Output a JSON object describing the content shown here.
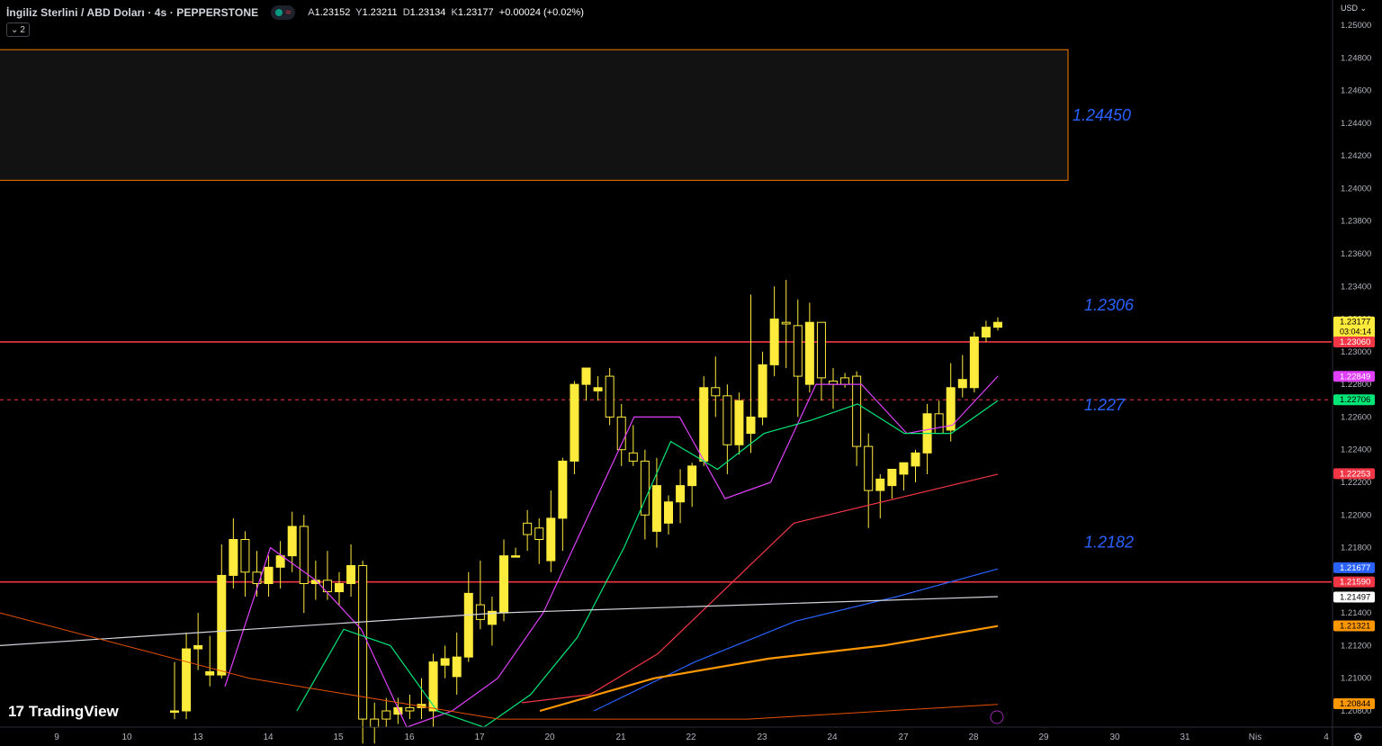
{
  "header": {
    "title": "İngiliz Sterlini / ABD Doları · 4s · PEPPERSTONE",
    "ohlc": {
      "open_label": "A",
      "open": "1.23152",
      "high_label": "Y",
      "high": "1.23211",
      "low_label": "D",
      "low": "1.23134",
      "close_label": "K",
      "close": "1.23177",
      "change": "+0.00024 (+0.02%)"
    },
    "indicator_count": "2",
    "currency": "USD"
  },
  "logo": {
    "text": "TradingView"
  },
  "colors": {
    "candle": "#ffeb3b",
    "wick": "#ffeb3b",
    "level_line": "#f23645",
    "zone_border": "#f57c00",
    "annotation": "#2962ff",
    "ma_purple": "#e040fb",
    "ma_green": "#00e676",
    "ma_red": "#f23645",
    "ma_blue": "#2962ff",
    "ma_white": "#d1d4dc",
    "ma_orange": "#ff9800",
    "ma_orange_thin": "#e65100"
  },
  "chart_data": {
    "type": "candlestick",
    "symbol": "GBPUSD",
    "timeframe": "4s",
    "ylim": [
      1.2075,
      1.251
    ],
    "y_ticks": [
      "1.25000",
      "1.24800",
      "1.24600",
      "1.24400",
      "1.24200",
      "1.24000",
      "1.23800",
      "1.23600",
      "1.23400",
      "1.23200",
      "1.23000",
      "1.22800",
      "1.22600",
      "1.22400",
      "1.22200",
      "1.22000",
      "1.21800",
      "1.21600",
      "1.21400",
      "1.21200",
      "1.21000",
      "1.20800"
    ],
    "x_ticks": [
      "9",
      "10",
      "13",
      "14",
      "15",
      "16",
      "17",
      "20",
      "21",
      "22",
      "23",
      "24",
      "27",
      "28",
      "29",
      "30",
      "31",
      "Nis",
      "4"
    ],
    "candles": [
      [
        1.208,
        1.211,
        1.2075,
        1.208
      ],
      [
        1.208,
        1.2128,
        1.2075,
        1.2118
      ],
      [
        1.2118,
        1.214,
        1.2105,
        1.212
      ],
      [
        1.2102,
        1.2126,
        1.2095,
        1.2104
      ],
      [
        1.2102,
        1.2182,
        1.21,
        1.2163
      ],
      [
        1.2163,
        1.2198,
        1.2155,
        1.2185
      ],
      [
        1.2185,
        1.219,
        1.215,
        1.2165
      ],
      [
        1.2165,
        1.2178,
        1.215,
        1.2158
      ],
      [
        1.2158,
        1.2175,
        1.215,
        1.2168
      ],
      [
        1.2168,
        1.2184,
        1.2155,
        1.2175
      ],
      [
        1.2175,
        1.2202,
        1.2165,
        1.2193
      ],
      [
        1.2193,
        1.22,
        1.214,
        1.2158
      ],
      [
        1.2158,
        1.2172,
        1.2148,
        1.216
      ],
      [
        1.216,
        1.2178,
        1.2148,
        1.2153
      ],
      [
        1.2153,
        1.2165,
        1.2145,
        1.2158
      ],
      [
        1.2158,
        1.2182,
        1.215,
        1.2169
      ],
      [
        1.2169,
        1.2172,
        1.206,
        1.2075
      ],
      [
        1.2075,
        1.2085,
        1.206,
        1.207
      ],
      [
        1.208,
        1.2088,
        1.207,
        1.2075
      ],
      [
        1.2078,
        1.2088,
        1.2072,
        1.2082
      ],
      [
        1.2082,
        1.209,
        1.2075,
        1.208
      ],
      [
        1.2082,
        1.21,
        1.2075,
        1.2084
      ],
      [
        1.208,
        1.2115,
        1.207,
        1.211
      ],
      [
        1.2108,
        1.212,
        1.21,
        1.2112
      ],
      [
        1.2101,
        1.2128,
        1.209,
        1.2113
      ],
      [
        1.2113,
        1.2165,
        1.211,
        1.2152
      ],
      [
        1.2145,
        1.2172,
        1.213,
        1.2136
      ],
      [
        1.2133,
        1.215,
        1.212,
        1.2141
      ],
      [
        1.214,
        1.2185,
        1.2135,
        1.2175
      ],
      [
        1.2175,
        1.218,
        1.2175,
        1.2175
      ],
      [
        1.2195,
        1.2203,
        1.2178,
        1.2188
      ],
      [
        1.2192,
        1.2198,
        1.217,
        1.2185
      ],
      [
        1.2172,
        1.2215,
        1.2165,
        1.2198
      ],
      [
        1.2198,
        1.2235,
        1.2178,
        1.2233
      ],
      [
        1.2233,
        1.2282,
        1.2225,
        1.228
      ],
      [
        1.228,
        1.2285,
        1.227,
        1.229
      ],
      [
        1.2276,
        1.2285,
        1.227,
        1.2278
      ],
      [
        1.2285,
        1.229,
        1.2255,
        1.226
      ],
      [
        1.226,
        1.2268,
        1.223,
        1.224
      ],
      [
        1.2238,
        1.2255,
        1.223,
        1.2233
      ],
      [
        1.2233,
        1.224,
        1.2185,
        1.22
      ],
      [
        1.219,
        1.2235,
        1.218,
        1.2218
      ],
      [
        1.2195,
        1.2212,
        1.2188,
        1.2208
      ],
      [
        1.2208,
        1.2228,
        1.2195,
        1.2218
      ],
      [
        1.2218,
        1.2232,
        1.2205,
        1.223
      ],
      [
        1.2233,
        1.2285,
        1.223,
        1.2278
      ],
      [
        1.2278,
        1.2297,
        1.226,
        1.2273
      ],
      [
        1.2273,
        1.228,
        1.2225,
        1.2243
      ],
      [
        1.2243,
        1.2275,
        1.2237,
        1.227
      ],
      [
        1.225,
        1.2335,
        1.2238,
        1.226
      ],
      [
        1.226,
        1.23,
        1.2255,
        1.2292
      ],
      [
        1.2292,
        1.234,
        1.2285,
        1.232
      ],
      [
        1.2318,
        1.2344,
        1.229,
        1.2317
      ],
      [
        1.2316,
        1.2332,
        1.226,
        1.2285
      ],
      [
        1.228,
        1.233,
        1.2275,
        1.2318
      ],
      [
        1.2318,
        1.2318,
        1.227,
        1.2284
      ],
      [
        1.2282,
        1.229,
        1.2265,
        1.228
      ],
      [
        1.2284,
        1.2287,
        1.2278,
        1.228
      ],
      [
        1.2285,
        1.2288,
        1.223,
        1.2242
      ],
      [
        1.2242,
        1.225,
        1.2192,
        1.2215
      ],
      [
        1.2215,
        1.2225,
        1.2198,
        1.2222
      ],
      [
        1.2218,
        1.2228,
        1.221,
        1.2228
      ],
      [
        1.2225,
        1.223,
        1.2215,
        1.2232
      ],
      [
        1.223,
        1.224,
        1.222,
        1.2238
      ],
      [
        1.2238,
        1.2268,
        1.2225,
        1.2262
      ],
      [
        1.2262,
        1.227,
        1.225,
        1.225
      ],
      [
        1.2252,
        1.2293,
        1.2245,
        1.2278
      ],
      [
        1.2278,
        1.2298,
        1.2272,
        1.2283
      ],
      [
        1.2278,
        1.2312,
        1.2275,
        1.2309
      ],
      [
        1.2309,
        1.2319,
        1.2306,
        1.2315
      ],
      [
        1.2315,
        1.2321,
        1.2313,
        1.2318
      ]
    ],
    "moving_averages": [
      {
        "color": "#e040fb",
        "values": [
          1.2095,
          1.218,
          1.216,
          1.213,
          1.207,
          1.208,
          1.21,
          1.214,
          1.22,
          1.226,
          1.226,
          1.221,
          1.222,
          1.228,
          1.228,
          1.225,
          1.2255,
          1.2285
        ]
      },
      {
        "color": "#00e676",
        "values": [
          1.208,
          1.213,
          1.212,
          1.208,
          1.207,
          1.209,
          1.2125,
          1.218,
          1.2245,
          1.2228,
          1.225,
          1.2258,
          1.2268,
          1.225,
          1.225,
          1.227
        ]
      },
      {
        "color": "#f23645",
        "values": [
          1.2085,
          1.209,
          1.2115,
          1.2155,
          1.2195,
          1.2205,
          1.2215,
          1.2225
        ]
      },
      {
        "color": "#2962ff",
        "values": [
          1.208,
          1.211,
          1.2135,
          1.215,
          1.2167
        ]
      },
      {
        "color": "#d1d4dc",
        "values": [
          1.212,
          1.213,
          1.214,
          1.2145,
          1.215
        ]
      },
      {
        "color": "#ff9800",
        "values": [
          1.208,
          1.21,
          1.2112,
          1.212,
          1.2132
        ]
      },
      {
        "color": "#e65100",
        "values": [
          1.214,
          1.21,
          1.2075,
          1.2075,
          1.2084
        ]
      }
    ],
    "horizontal_levels": [
      {
        "price": 1.2306,
        "label": "1.2306",
        "style": "solid",
        "color": "#f23645"
      },
      {
        "price": 1.2159,
        "label": "1.2182",
        "style": "solid",
        "color": "#f23645"
      },
      {
        "price": 1.22706,
        "label": "1.227",
        "style": "dashed",
        "color": "#f23645"
      }
    ],
    "zone": {
      "top": 1.2485,
      "bottom": 1.2405,
      "label": "1.24450"
    },
    "annotations": [
      "1.24450",
      "1.2306",
      "1.227",
      "1.2182"
    ],
    "price_labels": [
      {
        "text": "1.23177",
        "sub": "03:04:14",
        "bg": "#ffeb3b",
        "fg": "#000000",
        "price": 1.23177
      },
      {
        "text": "1.23060",
        "bg": "#f23645",
        "fg": "#ffffff",
        "price": 1.2306
      },
      {
        "text": "1.22849",
        "bg": "#e040fb",
        "fg": "#ffffff",
        "price": 1.22849
      },
      {
        "text": "1.22706",
        "bg": "#00e676",
        "fg": "#000000",
        "price": 1.22706
      },
      {
        "text": "1.22253",
        "bg": "#f23645",
        "fg": "#ffffff",
        "price": 1.22253
      },
      {
        "text": "1.21677",
        "bg": "#2962ff",
        "fg": "#ffffff",
        "price": 1.21677
      },
      {
        "text": "1.21590",
        "bg": "#f23645",
        "fg": "#ffffff",
        "price": 1.2159
      },
      {
        "text": "1.21497",
        "bg": "#ffffff",
        "fg": "#000000",
        "price": 1.21497
      },
      {
        "text": "1.21321",
        "bg": "#ff9800",
        "fg": "#000000",
        "price": 1.21321
      },
      {
        "text": "1.20844",
        "bg": "#ff9800",
        "fg": "#000000",
        "price": 1.20844
      }
    ],
    "grid": false,
    "legend": "none"
  }
}
